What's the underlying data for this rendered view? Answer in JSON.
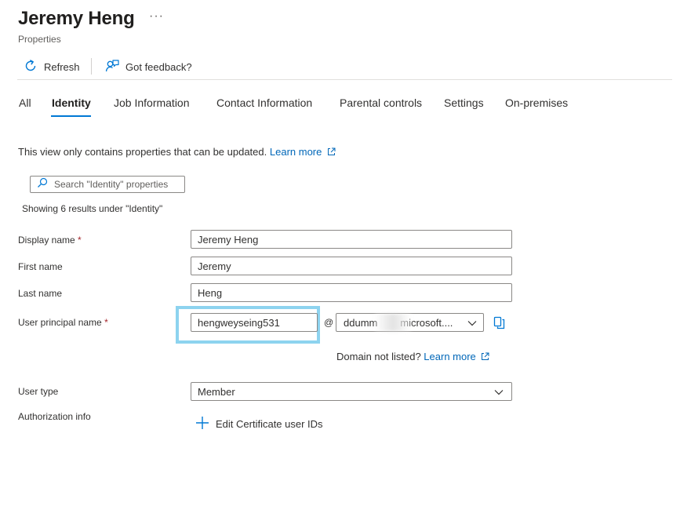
{
  "header": {
    "title": "Jeremy Heng",
    "more_label": "···",
    "subtitle": "Properties"
  },
  "toolbar": {
    "refresh_label": "Refresh",
    "feedback_label": "Got feedback?"
  },
  "tabs": [
    "All",
    "Identity",
    "Job Information",
    "Contact Information",
    "Parental controls",
    "Settings",
    "On-premises"
  ],
  "active_tab": "Identity",
  "info": {
    "text": "This view only contains properties that can be updated.",
    "link": "Learn more"
  },
  "search": {
    "placeholder": "Search \"Identity\" properties",
    "results_text": "Showing 6 results under \"Identity\""
  },
  "form": {
    "display_name": {
      "label": "Display name",
      "required_mark": "*",
      "value": "Jeremy Heng"
    },
    "first_name": {
      "label": "First name",
      "value": "Jeremy"
    },
    "last_name": {
      "label": "Last name",
      "value": "Heng"
    },
    "upn": {
      "label": "User principal name",
      "required_mark": "*",
      "value": "hengweyseing531",
      "at": "@",
      "domain_value": "ddumm        microsoft...."
    },
    "domain_note": {
      "text": "Domain not listed?",
      "link": "Learn more"
    },
    "user_type": {
      "label": "User type",
      "value": "Member"
    },
    "authorization": {
      "label": "Authorization info",
      "action": "Edit Certificate user IDs"
    }
  },
  "colors": {
    "accent": "#0078d4",
    "link": "#0067b8",
    "required": "#a4262c",
    "highlight": "#8dd3ef"
  },
  "icons": [
    "refresh-icon",
    "feedback-icon",
    "external-link-icon",
    "search-icon",
    "chevron-down-icon",
    "copy-icon",
    "plus-icon"
  ]
}
